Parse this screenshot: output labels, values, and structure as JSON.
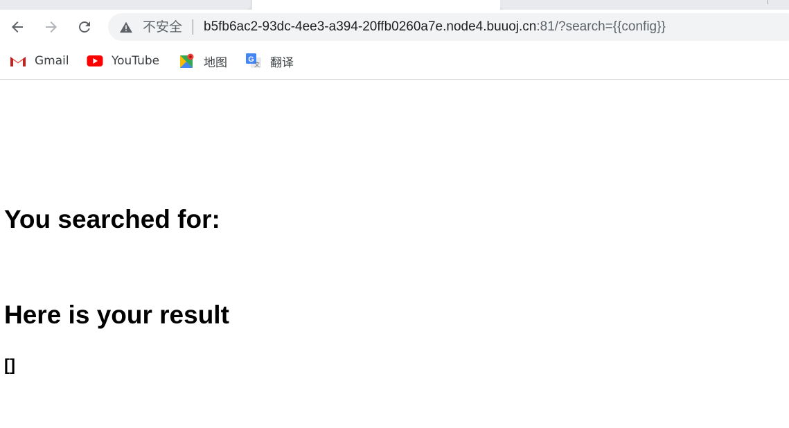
{
  "browser": {
    "address_bar": {
      "security_label": "不安全",
      "url_host": "b5fb6ac2-93dc-4ee3-a394-20ffb0260a7e.node4.buuoj.cn",
      "url_rest": ":81/?search={{config}}"
    },
    "bookmarks": [
      {
        "label": "Gmail",
        "icon": "gmail-icon"
      },
      {
        "label": "YouTube",
        "icon": "youtube-icon"
      },
      {
        "label": "地图",
        "icon": "maps-icon"
      },
      {
        "label": "翻译",
        "icon": "translate-icon"
      }
    ]
  },
  "page": {
    "searched_heading": "You searched for:",
    "result_heading": "Here is your result",
    "result_value": "[]"
  },
  "colors": {
    "toolbar_bg": "#ffffff",
    "omnibox_bg": "#f1f3f4",
    "tabstrip_bg": "#dee1e6",
    "youtube_red": "#ff0000",
    "gmail_red": "#ea4335"
  }
}
